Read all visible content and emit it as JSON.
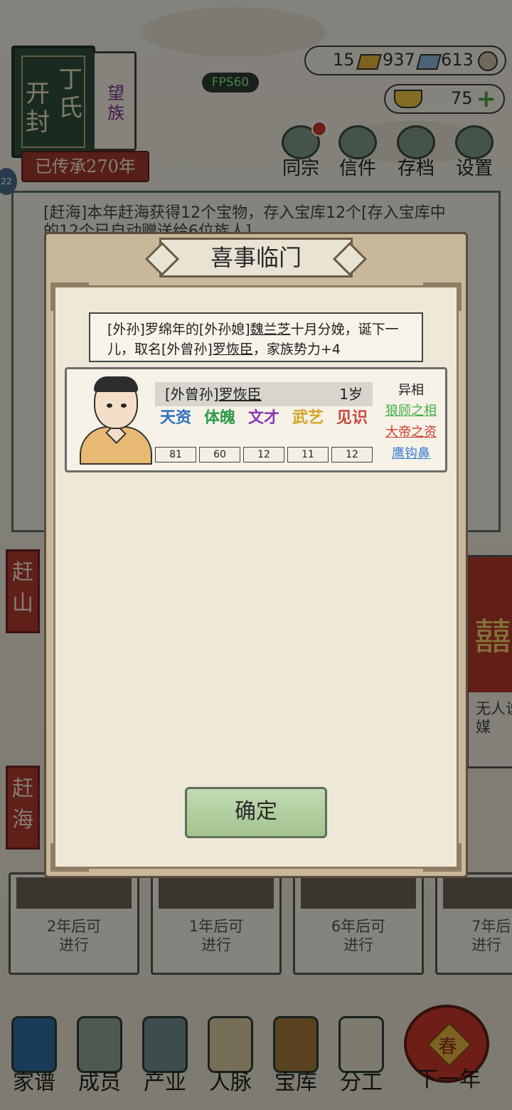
{
  "header": {
    "family_city": "开封",
    "family_name": "丁氏",
    "family_rank": "望族",
    "inherit_label": "已传承270年",
    "side_badge": "22"
  },
  "currency": {
    "gold": "15",
    "silver": "937",
    "coin": "613",
    "ingot": "75"
  },
  "fps": "FPS60",
  "top_buttons": [
    {
      "label": "同宗",
      "icon": "clan-book-icon",
      "has_dot": true
    },
    {
      "label": "信件",
      "icon": "letter-icon",
      "has_dot": false
    },
    {
      "label": "存档",
      "icon": "save-scroll-icon",
      "has_dot": false
    },
    {
      "label": "设置",
      "icon": "gear-icon",
      "has_dot": false
    }
  ],
  "log_text": "[赶海]本年赶海获得12个宝物，存入宝库12个[存入宝库中的12个已自动赠送给6位族人]",
  "side_tags": {
    "mountain": "赶山",
    "sea": "赶海"
  },
  "right_card": {
    "symbol": "囍",
    "text": "无人说媒"
  },
  "cards": [
    {
      "line1": "2年后可",
      "line2": "进行"
    },
    {
      "line1": "1年后可",
      "line2": "进行"
    },
    {
      "line1": "6年后可",
      "line2": "进行"
    },
    {
      "line1": "7年后",
      "line2": "进行"
    }
  ],
  "nav": [
    {
      "label": "家谱",
      "icon": "genealogy-book-icon"
    },
    {
      "label": "成员",
      "icon": "member-icon"
    },
    {
      "label": "产业",
      "icon": "building-icon"
    },
    {
      "label": "人脉",
      "icon": "network-icon"
    },
    {
      "label": "宝库",
      "icon": "treasure-chest-icon"
    },
    {
      "label": "分工",
      "icon": "scroll-icon"
    },
    {
      "label": "下一年",
      "icon": "lantern-icon",
      "badge": "春"
    }
  ],
  "dialog": {
    "title": "喜事临门",
    "message": {
      "p1": "[外孙]罗绵年的[外孙媳]",
      "wife": "魏兰芝",
      "p2": "十月分娩，诞下一儿，取名[外曾孙]",
      "child": "罗恢臣",
      "p3": "，家族势力+4"
    },
    "character": {
      "relation": "[外曾孙]",
      "name": "罗恢臣",
      "age": "1岁",
      "stats": [
        {
          "label": "天资",
          "value": "81",
          "color": "#2f6fc1"
        },
        {
          "label": "体魄",
          "value": "60",
          "color": "#2e9a4a"
        },
        {
          "label": "文才",
          "value": "12",
          "color": "#8a38b8"
        },
        {
          "label": "武艺",
          "value": "11",
          "color": "#d2a423"
        },
        {
          "label": "见识",
          "value": "12",
          "color": "#c8473d"
        }
      ],
      "traits_header": "异相",
      "traits": [
        {
          "label": "狼顾之相",
          "color": "#45b04a"
        },
        {
          "label": "大帝之资",
          "color": "#d13a2f"
        },
        {
          "label": "鹰钩鼻",
          "color": "#3f7fd0"
        }
      ]
    },
    "confirm_label": "确定"
  }
}
